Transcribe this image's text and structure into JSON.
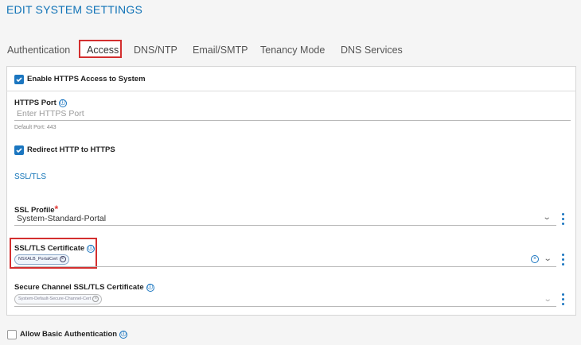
{
  "header": {
    "title": "EDIT SYSTEM SETTINGS"
  },
  "tabs": [
    {
      "label": "Authentication"
    },
    {
      "label": "Access"
    },
    {
      "label": "DNS/NTP"
    },
    {
      "label": "Email/SMTP"
    },
    {
      "label": "Tenancy Mode"
    },
    {
      "label": "DNS Services"
    }
  ],
  "active_tab": "Access",
  "enable_https": {
    "label": "Enable HTTPS Access to System",
    "checked": true
  },
  "https_port": {
    "label": "HTTPS Port",
    "placeholder": "Enter HTTPS Port",
    "hint": "Default Port: 443"
  },
  "redirect_http": {
    "label": "Redirect HTTP to HTTPS",
    "checked": true
  },
  "ssl_tls_section": "SSL/TLS",
  "ssl_profile": {
    "label": "SSL Profile",
    "required_mark": "*",
    "value": "System-Standard-Portal"
  },
  "ssl_cert": {
    "label": "SSL/TLS Certificate",
    "chip": "NSXALB_PortalCert"
  },
  "secure_channel_cert": {
    "label": "Secure Channel SSL/TLS Certificate",
    "chip": "System-Default-Secure-Channel-Cert"
  },
  "allow_basic_auth": {
    "label": "Allow Basic Authentication",
    "checked": false
  },
  "icons": {
    "info": "ⓘ",
    "close": "×",
    "chevron": "⌄",
    "check": "check-icon"
  },
  "colors": {
    "accent": "#0f72b6",
    "checkbox": "#1b76c0",
    "highlight": "#d32f2f",
    "required": "#e53935"
  }
}
